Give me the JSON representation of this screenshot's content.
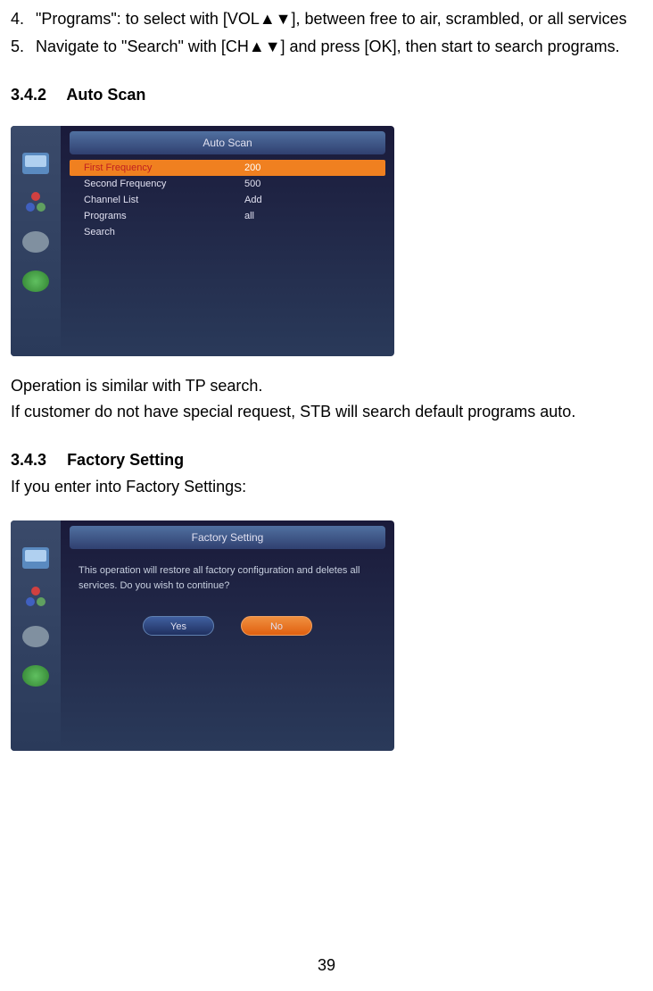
{
  "list": {
    "item4": {
      "num": "4.",
      "text": "\"Programs\": to select with [VOL▲▼], between free to air, scrambled, or all services"
    },
    "item5": {
      "num": "5.",
      "text": "Navigate to \"Search\" with [CH▲▼] and press [OK], then start to search programs."
    }
  },
  "section342": {
    "num": "3.4.2",
    "title": "Auto  Scan"
  },
  "autoscan": {
    "title": "Auto Scan",
    "rows": {
      "r0": {
        "label": "First Frequency",
        "value": "200"
      },
      "r1": {
        "label": "Second Frequency",
        "value": "500"
      },
      "r2": {
        "label": "Channel List",
        "value": "Add"
      },
      "r3": {
        "label": "Programs",
        "value": "all"
      },
      "r4": {
        "label": "Search",
        "value": ""
      }
    }
  },
  "para1": "Operation is similar with TP search.",
  "para2": "If customer do not have special request, STB will search default programs auto.",
  "section343": {
    "num": "3.4.3",
    "title": "Factory  Setting"
  },
  "para3": "If you enter into Factory Settings:",
  "factory": {
    "title": "Factory Setting",
    "message": "This operation will restore all factory configuration and deletes all services. Do you wish to continue?",
    "yes": "Yes",
    "no": "No"
  },
  "pageNumber": "39"
}
